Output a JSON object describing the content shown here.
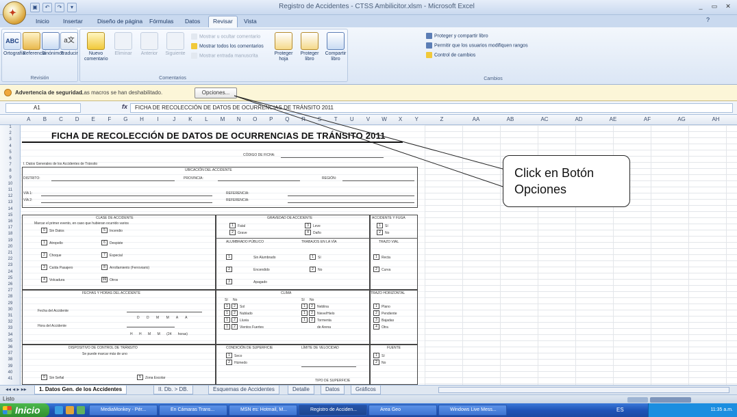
{
  "window": {
    "title": "Registro de Accidentes - CTSS Ambilicitor.xlsm - Microsoft Excel"
  },
  "tabs": [
    "Inicio",
    "Insertar",
    "Diseño de página",
    "Fórmulas",
    "Datos",
    "Revisar",
    "Vista"
  ],
  "active_tab": "Revisar",
  "ribbon": {
    "revision": {
      "label": "Revisión",
      "items": [
        "Ortografía",
        "Referencia",
        "Sinónimos",
        "Traducir"
      ]
    },
    "comentarios": {
      "label": "Comentarios",
      "items": [
        "Nuevo comentario",
        "Eliminar",
        "Anterior",
        "Siguiente"
      ],
      "small": [
        "Mostrar u ocultar comentario",
        "Mostrar todos los comentarios",
        "Mostrar entrada manuscrita"
      ]
    },
    "cambios": {
      "label": "Cambios",
      "items": [
        "Proteger hoja",
        "Proteger libro",
        "Compartir libro"
      ],
      "small": [
        "Proteger y compartir libro",
        "Permitir que los usuarios modifiquen rangos",
        "Control de cambios"
      ]
    }
  },
  "security": {
    "title": "Advertencia de seguridad",
    "message": "Las macros se han deshabilitado.",
    "button": "Opciones..."
  },
  "formula_bar": {
    "cell": "A1",
    "fx": "fx",
    "content": "FICHA DE RECOLECCIÓN DE DATOS DE OCURRENCIAS DE TRÁNSITO 2011"
  },
  "columns": [
    "A",
    "B",
    "C",
    "D",
    "E",
    "F",
    "G",
    "H",
    "I",
    "J",
    "K",
    "L",
    "M",
    "N",
    "O",
    "P",
    "Q",
    "R",
    "S",
    "T",
    "U",
    "V",
    "W",
    "X",
    "Y",
    "Z",
    "AA",
    "AB",
    "AC",
    "AD",
    "AE",
    "AF",
    "AG",
    "AH"
  ],
  "rows": [
    "1",
    "2",
    "3",
    "4",
    "5",
    "6",
    "7",
    "8",
    "9",
    "10",
    "11",
    "12",
    "13",
    "14",
    "15",
    "16",
    "17",
    "18",
    "19",
    "20",
    "21",
    "22",
    "23",
    "24",
    "25",
    "26",
    "27",
    "28",
    "29",
    "30",
    "31",
    "32",
    "33",
    "34",
    "35",
    "36",
    "37",
    "38",
    "39",
    "40",
    "41"
  ],
  "form": {
    "title": "FICHA DE RECOLECCIÓN DE DATOS DE OCURRENCIAS DE TRÁNSITO 2011",
    "codigo": "CÓDIGO DE FICHA:",
    "section1": "I. Datos Generales de los Accidentes de Tránsito",
    "ubicacion": "UBICACIÓN DEL ACCIDENTE",
    "distrito": "DISTRITO:",
    "provincia": "PROVINCIA:",
    "region": "REGIÓN:",
    "via1": "VÍA 1:",
    "via2": "VÍA 2:",
    "referencia": "REFERENCIA:",
    "clase": "CLASE DE ACCIDENTE",
    "clase_note": "Marcar el primer evento, en caso que hubieran ocurrido varios",
    "clases": [
      "Sin Datos",
      "Atropello",
      "Choque",
      "Caída Pasajero",
      "Volcadura",
      "Incendio",
      "Despiste",
      "Especial",
      "Arrollamiento (Ferroviario)",
      "Otros"
    ],
    "clase_nums": [
      "0",
      "1",
      "2",
      "3",
      "4",
      "5",
      "6",
      "7",
      "8",
      "99"
    ],
    "gravedad": "GRAVEDAD DE ACCIDENTE",
    "gravedades": [
      "Fatal",
      "Grave",
      "Leve",
      "Daño"
    ],
    "accidente_fuga": "ACCIDENTE Y FUGA",
    "si": "Sí",
    "no": "No",
    "alumbrado": "ALUMBRADO PÚBLICO",
    "alumbrados": [
      "Sin Alumbrado",
      "Encendido",
      "Apagado"
    ],
    "trabajos": "TRABAJOS EN LA VÍA",
    "trazo_vial": "TRAZO VIAL",
    "trazos": [
      "Recta",
      "Curva"
    ],
    "fechas": "FECHAS Y HORAS DEL ACCIDENTE",
    "fecha_label": "Fecha del Accidente",
    "hora_label": "Hora del Accidente",
    "fecha_units": [
      "D",
      "D",
      "M",
      "M",
      "A",
      "A"
    ],
    "hora_units": [
      "H",
      "H",
      "M",
      "M",
      "(24 horas)"
    ],
    "clima": "CLIMA",
    "climas": [
      "Sol",
      "Nublado",
      "Lluvia",
      "Vientos Fuertes",
      "Neblina",
      "Nieve/Hielo",
      "Tormenta",
      "de Arena"
    ],
    "trazo_horizontal": "TRAZO HORIZONTAL",
    "horizontales": [
      "Plano",
      "Pendiente",
      "Bajadas",
      "Otra"
    ],
    "dispositivo": "DISPOSITIVO DE CONTROL DE TRÁNSITO",
    "dispositivo_note": "Se puede marcar más de uno",
    "condicion": "CONDICIÓN DE SUPERFICIE",
    "condiciones": [
      "Seco",
      "Húmedo"
    ],
    "limite": "LÍMITE DE VELOCIDAD",
    "fuente": "FUENTE",
    "sin_senal": "Sin Señal",
    "zona_escolar": "Zona Escolar",
    "tipo_superficie": "TIPO DE SUPERFICIE"
  },
  "callout": "Click en Botón Opciones",
  "sheet_tabs": [
    "1. Datos Gen. de los Accidentes",
    "II. Db. > DB.",
    "Esquemas de Accidentes",
    "Detalle",
    "Datos",
    "Gráficos"
  ],
  "status": {
    "text": "Listo"
  },
  "taskbar": {
    "start": "Inicio",
    "items": [
      "MediaMonkey - Pér...",
      "En Cámaras Trans...",
      "MSN es: Hotmail, M...",
      "Registro de Acciden...",
      "Area Geo",
      "Windows Live Mess..."
    ],
    "lang": "ES",
    "clock": "11:35 a.m."
  }
}
